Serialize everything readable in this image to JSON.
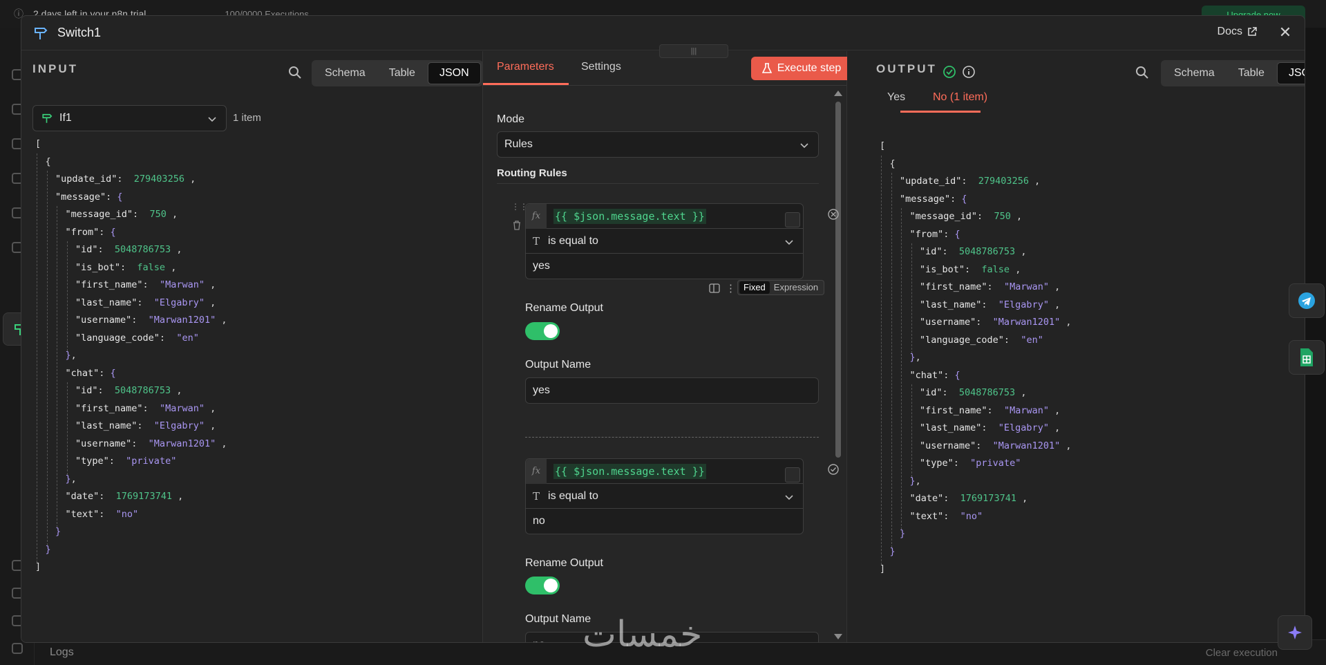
{
  "background": {
    "trial_text": "2 days left in your n8n trial",
    "executions_text": "100/0000 Executions",
    "upgrade_label": "Upgrade now",
    "logs_label": "Logs",
    "clear_label": "Clear execution"
  },
  "modal": {
    "title": "Switch1",
    "docs_label": "Docs"
  },
  "input_panel": {
    "title": "INPUT",
    "views": [
      "Schema",
      "Table",
      "JSON"
    ],
    "active_view": "JSON",
    "node_select": "If1",
    "item_count": "1 item"
  },
  "params_panel": {
    "tabs": [
      "Parameters",
      "Settings"
    ],
    "active_tab": "Parameters",
    "execute_label": "Execute step",
    "mode_label": "Mode",
    "mode_value": "Rules",
    "routing_label": "Routing Rules",
    "rules": [
      {
        "expression": "{{ $json.message.text }}",
        "operator": "is equal to",
        "value": "yes",
        "rename_label": "Rename Output",
        "rename_on": true,
        "output_name_label": "Output Name",
        "output_name": "yes"
      },
      {
        "expression": "{{ $json.message.text }}",
        "operator": "is equal to",
        "value": "no",
        "rename_label": "Rename Output",
        "rename_on": true,
        "output_name_label": "Output Name",
        "output_name": "no"
      }
    ],
    "fixed_label": "Fixed",
    "expression_label": "Expression"
  },
  "output_panel": {
    "title": "OUTPUT",
    "views": [
      "Schema",
      "Table",
      "JSON"
    ],
    "active_view": "JSON",
    "branch_tabs": [
      "Yes",
      "No (1 item)"
    ],
    "active_branch": "No (1 item)"
  },
  "json_lines": [
    {
      "d": 0,
      "t": [
        [
          "p",
          "["
        ]
      ]
    },
    {
      "d": 1,
      "t": [
        [
          "p",
          "{"
        ]
      ]
    },
    {
      "d": 2,
      "t": [
        [
          "k",
          "\"update_id\""
        ],
        [
          "p",
          ":  "
        ],
        [
          "n",
          "279403256"
        ],
        [
          "p",
          " ,"
        ]
      ]
    },
    {
      "d": 2,
      "t": [
        [
          "k",
          "\"message\""
        ],
        [
          "p",
          ": "
        ],
        [
          "b",
          "{"
        ]
      ]
    },
    {
      "d": 3,
      "t": [
        [
          "k",
          "\"message_id\""
        ],
        [
          "p",
          ":  "
        ],
        [
          "n",
          "750"
        ],
        [
          "p",
          " ,"
        ]
      ]
    },
    {
      "d": 3,
      "t": [
        [
          "k",
          "\"from\""
        ],
        [
          "p",
          ": "
        ],
        [
          "b",
          "{"
        ]
      ]
    },
    {
      "d": 4,
      "t": [
        [
          "k",
          "\"id\""
        ],
        [
          "p",
          ":  "
        ],
        [
          "n",
          "5048786753"
        ],
        [
          "p",
          " ,"
        ]
      ]
    },
    {
      "d": 4,
      "t": [
        [
          "k",
          "\"is_bot\""
        ],
        [
          "p",
          ":  "
        ],
        [
          "n",
          "false"
        ],
        [
          "p",
          " ,"
        ]
      ]
    },
    {
      "d": 4,
      "t": [
        [
          "k",
          "\"first_name\""
        ],
        [
          "p",
          ":  "
        ],
        [
          "s",
          "\"Marwan\""
        ],
        [
          "p",
          " ,"
        ]
      ]
    },
    {
      "d": 4,
      "t": [
        [
          "k",
          "\"last_name\""
        ],
        [
          "p",
          ":  "
        ],
        [
          "s",
          "\"Elgabry\""
        ],
        [
          "p",
          " ,"
        ]
      ]
    },
    {
      "d": 4,
      "t": [
        [
          "k",
          "\"username\""
        ],
        [
          "p",
          ":  "
        ],
        [
          "s",
          "\"Marwan1201\""
        ],
        [
          "p",
          " ,"
        ]
      ]
    },
    {
      "d": 4,
      "t": [
        [
          "k",
          "\"language_code\""
        ],
        [
          "p",
          ":  "
        ],
        [
          "s",
          "\"en\""
        ]
      ]
    },
    {
      "d": 3,
      "t": [
        [
          "b",
          "}"
        ],
        [
          "p",
          ","
        ]
      ]
    },
    {
      "d": 3,
      "t": [
        [
          "k",
          "\"chat\""
        ],
        [
          "p",
          ": "
        ],
        [
          "b",
          "{"
        ]
      ]
    },
    {
      "d": 4,
      "t": [
        [
          "k",
          "\"id\""
        ],
        [
          "p",
          ":  "
        ],
        [
          "n",
          "5048786753"
        ],
        [
          "p",
          " ,"
        ]
      ]
    },
    {
      "d": 4,
      "t": [
        [
          "k",
          "\"first_name\""
        ],
        [
          "p",
          ":  "
        ],
        [
          "s",
          "\"Marwan\""
        ],
        [
          "p",
          " ,"
        ]
      ]
    },
    {
      "d": 4,
      "t": [
        [
          "k",
          "\"last_name\""
        ],
        [
          "p",
          ":  "
        ],
        [
          "s",
          "\"Elgabry\""
        ],
        [
          "p",
          " ,"
        ]
      ]
    },
    {
      "d": 4,
      "t": [
        [
          "k",
          "\"username\""
        ],
        [
          "p",
          ":  "
        ],
        [
          "s",
          "\"Marwan1201\""
        ],
        [
          "p",
          " ,"
        ]
      ]
    },
    {
      "d": 4,
      "t": [
        [
          "k",
          "\"type\""
        ],
        [
          "p",
          ":  "
        ],
        [
          "s",
          "\"private\""
        ]
      ]
    },
    {
      "d": 3,
      "t": [
        [
          "b",
          "}"
        ],
        [
          "p",
          ","
        ]
      ]
    },
    {
      "d": 3,
      "t": [
        [
          "k",
          "\"date\""
        ],
        [
          "p",
          ":  "
        ],
        [
          "n",
          "1769173741"
        ],
        [
          "p",
          " ,"
        ]
      ]
    },
    {
      "d": 3,
      "t": [
        [
          "k",
          "\"text\""
        ],
        [
          "p",
          ":  "
        ],
        [
          "s",
          "\"no\""
        ]
      ]
    },
    {
      "d": 2,
      "t": [
        [
          "b",
          "}"
        ]
      ]
    },
    {
      "d": 1,
      "t": [
        [
          "b",
          "}"
        ]
      ]
    },
    {
      "d": 0,
      "t": [
        [
          "p",
          "]"
        ]
      ]
    }
  ],
  "watermark": "خمسات",
  "colors": {
    "accent": "#ff6d5a",
    "success": "#2fbf69",
    "number": "#4fc48a",
    "string": "#a996f2"
  }
}
